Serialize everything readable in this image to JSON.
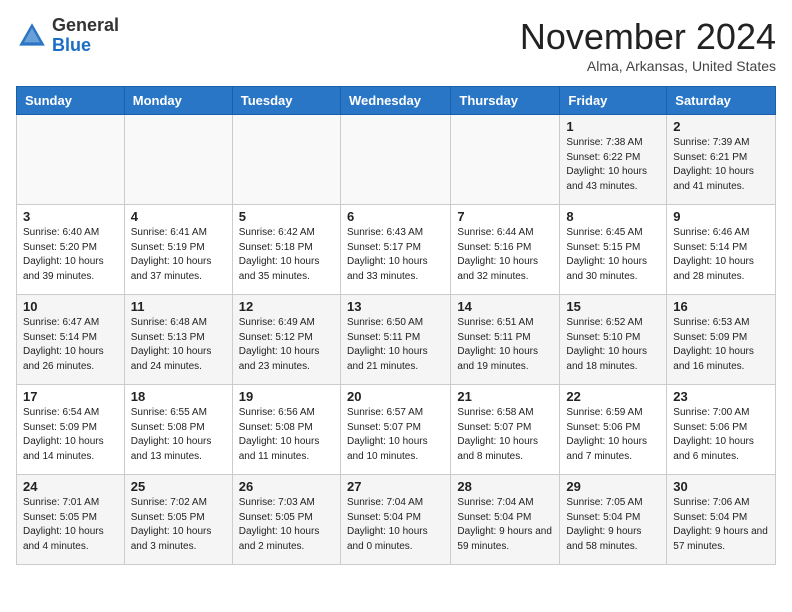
{
  "header": {
    "logo_general": "General",
    "logo_blue": "Blue",
    "month": "November 2024",
    "location": "Alma, Arkansas, United States"
  },
  "weekdays": [
    "Sunday",
    "Monday",
    "Tuesday",
    "Wednesday",
    "Thursday",
    "Friday",
    "Saturday"
  ],
  "weeks": [
    [
      {
        "day": "",
        "info": ""
      },
      {
        "day": "",
        "info": ""
      },
      {
        "day": "",
        "info": ""
      },
      {
        "day": "",
        "info": ""
      },
      {
        "day": "",
        "info": ""
      },
      {
        "day": "1",
        "info": "Sunrise: 7:38 AM\nSunset: 6:22 PM\nDaylight: 10 hours and 43 minutes."
      },
      {
        "day": "2",
        "info": "Sunrise: 7:39 AM\nSunset: 6:21 PM\nDaylight: 10 hours and 41 minutes."
      }
    ],
    [
      {
        "day": "3",
        "info": "Sunrise: 6:40 AM\nSunset: 5:20 PM\nDaylight: 10 hours and 39 minutes."
      },
      {
        "day": "4",
        "info": "Sunrise: 6:41 AM\nSunset: 5:19 PM\nDaylight: 10 hours and 37 minutes."
      },
      {
        "day": "5",
        "info": "Sunrise: 6:42 AM\nSunset: 5:18 PM\nDaylight: 10 hours and 35 minutes."
      },
      {
        "day": "6",
        "info": "Sunrise: 6:43 AM\nSunset: 5:17 PM\nDaylight: 10 hours and 33 minutes."
      },
      {
        "day": "7",
        "info": "Sunrise: 6:44 AM\nSunset: 5:16 PM\nDaylight: 10 hours and 32 minutes."
      },
      {
        "day": "8",
        "info": "Sunrise: 6:45 AM\nSunset: 5:15 PM\nDaylight: 10 hours and 30 minutes."
      },
      {
        "day": "9",
        "info": "Sunrise: 6:46 AM\nSunset: 5:14 PM\nDaylight: 10 hours and 28 minutes."
      }
    ],
    [
      {
        "day": "10",
        "info": "Sunrise: 6:47 AM\nSunset: 5:14 PM\nDaylight: 10 hours and 26 minutes."
      },
      {
        "day": "11",
        "info": "Sunrise: 6:48 AM\nSunset: 5:13 PM\nDaylight: 10 hours and 24 minutes."
      },
      {
        "day": "12",
        "info": "Sunrise: 6:49 AM\nSunset: 5:12 PM\nDaylight: 10 hours and 23 minutes."
      },
      {
        "day": "13",
        "info": "Sunrise: 6:50 AM\nSunset: 5:11 PM\nDaylight: 10 hours and 21 minutes."
      },
      {
        "day": "14",
        "info": "Sunrise: 6:51 AM\nSunset: 5:11 PM\nDaylight: 10 hours and 19 minutes."
      },
      {
        "day": "15",
        "info": "Sunrise: 6:52 AM\nSunset: 5:10 PM\nDaylight: 10 hours and 18 minutes."
      },
      {
        "day": "16",
        "info": "Sunrise: 6:53 AM\nSunset: 5:09 PM\nDaylight: 10 hours and 16 minutes."
      }
    ],
    [
      {
        "day": "17",
        "info": "Sunrise: 6:54 AM\nSunset: 5:09 PM\nDaylight: 10 hours and 14 minutes."
      },
      {
        "day": "18",
        "info": "Sunrise: 6:55 AM\nSunset: 5:08 PM\nDaylight: 10 hours and 13 minutes."
      },
      {
        "day": "19",
        "info": "Sunrise: 6:56 AM\nSunset: 5:08 PM\nDaylight: 10 hours and 11 minutes."
      },
      {
        "day": "20",
        "info": "Sunrise: 6:57 AM\nSunset: 5:07 PM\nDaylight: 10 hours and 10 minutes."
      },
      {
        "day": "21",
        "info": "Sunrise: 6:58 AM\nSunset: 5:07 PM\nDaylight: 10 hours and 8 minutes."
      },
      {
        "day": "22",
        "info": "Sunrise: 6:59 AM\nSunset: 5:06 PM\nDaylight: 10 hours and 7 minutes."
      },
      {
        "day": "23",
        "info": "Sunrise: 7:00 AM\nSunset: 5:06 PM\nDaylight: 10 hours and 6 minutes."
      }
    ],
    [
      {
        "day": "24",
        "info": "Sunrise: 7:01 AM\nSunset: 5:05 PM\nDaylight: 10 hours and 4 minutes."
      },
      {
        "day": "25",
        "info": "Sunrise: 7:02 AM\nSunset: 5:05 PM\nDaylight: 10 hours and 3 minutes."
      },
      {
        "day": "26",
        "info": "Sunrise: 7:03 AM\nSunset: 5:05 PM\nDaylight: 10 hours and 2 minutes."
      },
      {
        "day": "27",
        "info": "Sunrise: 7:04 AM\nSunset: 5:04 PM\nDaylight: 10 hours and 0 minutes."
      },
      {
        "day": "28",
        "info": "Sunrise: 7:04 AM\nSunset: 5:04 PM\nDaylight: 9 hours and 59 minutes."
      },
      {
        "day": "29",
        "info": "Sunrise: 7:05 AM\nSunset: 5:04 PM\nDaylight: 9 hours and 58 minutes."
      },
      {
        "day": "30",
        "info": "Sunrise: 7:06 AM\nSunset: 5:04 PM\nDaylight: 9 hours and 57 minutes."
      }
    ]
  ]
}
